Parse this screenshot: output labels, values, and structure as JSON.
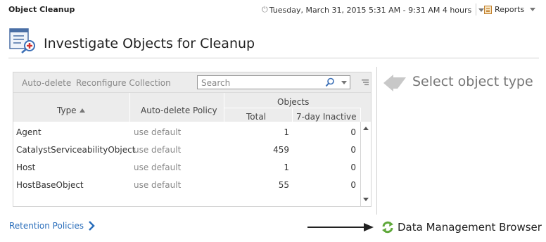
{
  "app": {
    "title": "Object Cleanup"
  },
  "header": {
    "timerange": "Tuesday, March 31, 2015 5:31 AM - 9:31 AM 4 hours",
    "reports_label": "Reports"
  },
  "page": {
    "title": "Investigate Objects for Cleanup"
  },
  "toolbar": {
    "autodelete_label": "Auto-delete",
    "reconfigure_label": "Reconfigure Collection",
    "search_placeholder": "Search"
  },
  "table": {
    "headers": {
      "type": "Type",
      "policy": "Auto-delete Policy",
      "objects": "Objects",
      "total": "Total",
      "inactive": "7-day Inactive"
    },
    "rows": [
      {
        "type": "Agent",
        "policy": "use default",
        "total": "1",
        "inactive": "0"
      },
      {
        "type": "CatalystServiceabilityObject",
        "policy": "use default",
        "total": "459",
        "inactive": "0"
      },
      {
        "type": "Host",
        "policy": "use default",
        "total": "1",
        "inactive": "0"
      },
      {
        "type": "HostBaseObject",
        "policy": "use default",
        "total": "55",
        "inactive": "0"
      }
    ]
  },
  "hint": {
    "select_object_type": "Select object type"
  },
  "footer": {
    "retention_link": "Retention Policies",
    "dmb_label": "Data Management Browser"
  },
  "colors": {
    "link": "#2a6ebb",
    "toolbar_bg": "#ececec",
    "refresh_green": "#5fa83a"
  }
}
